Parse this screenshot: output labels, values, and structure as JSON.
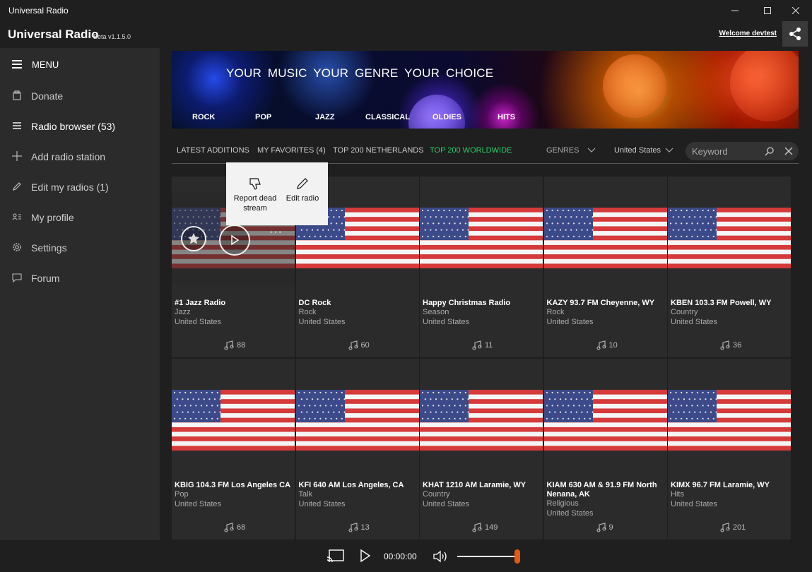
{
  "window": {
    "title": "Universal Radio",
    "controls": [
      "minimize",
      "maximize",
      "close"
    ]
  },
  "header": {
    "brand": "Universal Radio",
    "version": "Beta v1.1.5.0",
    "welcome": "Welcome devtest"
  },
  "sidebar": {
    "menu_label": "MENU",
    "items": [
      {
        "label": "Donate",
        "icon": "donate-icon"
      },
      {
        "label": "Radio browser (53)",
        "icon": "radio-list-icon"
      },
      {
        "label": "Add radio station",
        "icon": "plus-icon"
      },
      {
        "label": "Edit my radios (1)",
        "icon": "pencil-icon"
      },
      {
        "label": "My profile",
        "icon": "profile-icon"
      },
      {
        "label": "Settings",
        "icon": "gear-icon"
      },
      {
        "label": "Forum",
        "icon": "chat-icon"
      }
    ]
  },
  "banner": {
    "tagline": "YOUR MUSIC   YOUR GENRE   YOUR CHOICE",
    "genres": [
      "ROCK",
      "POP",
      "JAZZ",
      "CLASSICAL",
      "OLDIES",
      "HITS"
    ]
  },
  "tabs": {
    "items": [
      "LATEST ADDITIONS",
      "MY FAVORITES (4)",
      "TOP 200 NETHERLANDS",
      "TOP 200 WORLDWIDE"
    ],
    "active": "TOP 200 WORLDWIDE",
    "genres_filter": "GENRES",
    "country_filter": "United States",
    "search_placeholder": "Keyword"
  },
  "flyout": {
    "report_label": "Report dead stream",
    "edit_label": "Edit radio"
  },
  "stations": [
    {
      "name": "#1 Jazz Radio",
      "genre": "Jazz",
      "country": "United States",
      "plays": "88"
    },
    {
      "name": "DC Rock",
      "genre": "Rock",
      "country": "United States",
      "plays": "60"
    },
    {
      "name": "Happy Christmas Radio",
      "genre": "Season",
      "country": "United States",
      "plays": "11"
    },
    {
      "name": "KAZY 93.7 FM Cheyenne, WY",
      "genre": "Rock",
      "country": "United States",
      "plays": "10"
    },
    {
      "name": "KBEN 103.3 FM Powell, WY",
      "genre": "Country",
      "country": "United States",
      "plays": "36"
    },
    {
      "name": "KBIG 104.3 FM Los Angeles CA",
      "genre": "Pop",
      "country": "United States",
      "plays": "68"
    },
    {
      "name": "KFI 640 AM Los Angeles, CA",
      "genre": "Talk",
      "country": "United States",
      "plays": "13"
    },
    {
      "name": "KHAT 1210 AM Laramie, WY",
      "genre": "Country",
      "country": "United States",
      "plays": "149"
    },
    {
      "name": "KIAM 630 AM & 91.9 FM North Nenana, AK",
      "genre": "Religious",
      "country": "United States",
      "plays": "9"
    },
    {
      "name": "KIMX 96.7 FM Laramie, WY",
      "genre": "Hits",
      "country": "United States",
      "plays": "201"
    }
  ],
  "player": {
    "time": "00:00:00",
    "volume": 1.0
  },
  "colors": {
    "accent_green": "#22d06a",
    "slider_thumb": "#e05a1a",
    "sidebar_bg": "#2b2b2b",
    "app_bg": "#1f1f1f"
  }
}
